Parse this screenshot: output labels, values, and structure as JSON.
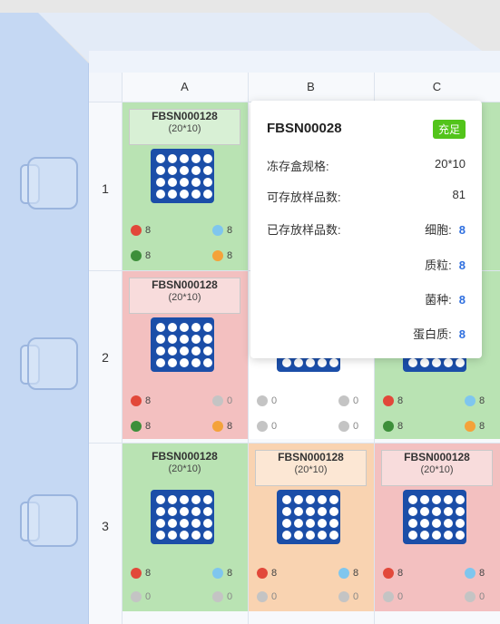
{
  "columns": [
    "A",
    "B",
    "C"
  ],
  "rows": [
    "1",
    "2",
    "3"
  ],
  "colors": {
    "cell_green": "#b9e3b3",
    "cell_red": "#f3c0c0",
    "cell_orange": "#f9d3b1",
    "box_blue": "#1b4ea8",
    "status_green": "#52c41a",
    "value_blue": "#2f6fdf",
    "dot_red": "#e2483a",
    "dot_blue": "#7fc6ee",
    "dot_green": "#3d8f3a",
    "dot_orange": "#f4a23a",
    "dot_gray": "#c4c4c4"
  },
  "cells": {
    "a1": {
      "code": "FBSN000128",
      "spec": "(20*10)",
      "c1": "8",
      "c2": "8",
      "c3": "8",
      "c4": "8"
    },
    "a2": {
      "code": "FBSN000128",
      "spec": "(20*10)",
      "c1": "8",
      "c2": "0",
      "c3": "8",
      "c4": "8"
    },
    "b2": {
      "c1": "0",
      "c2": "0",
      "c3": "0",
      "c4": "0"
    },
    "c2": {
      "c1": "8",
      "c2": "8",
      "c3": "8",
      "c4": "8"
    },
    "a3": {
      "code": "FBSN000128",
      "spec": "(20*10)",
      "c1": "8",
      "c2": "8",
      "c3": "0",
      "c4": "0"
    },
    "b3": {
      "code": "FBSN000128",
      "spec": "(20*10)",
      "c1": "8",
      "c2": "8",
      "c3": "0",
      "c4": "0"
    },
    "c3": {
      "code": "FBSN000128",
      "spec": "(20*10)",
      "c1": "8",
      "c2": "8",
      "c3": "0",
      "c4": "0"
    }
  },
  "tooltip": {
    "code": "FBSN00028",
    "status": "充足",
    "spec_label": "冻存盒规格:",
    "spec_value": "20*10",
    "capacity_label": "可存放样品数:",
    "capacity_value": "81",
    "stored_label": "已存放样品数:",
    "cell_label": "细胞:",
    "cell_value": "8",
    "plasmid_label": "质粒:",
    "plasmid_value": "8",
    "strain_label": "菌种:",
    "strain_value": "8",
    "protein_label": "蛋白质:",
    "protein_value": "8"
  }
}
